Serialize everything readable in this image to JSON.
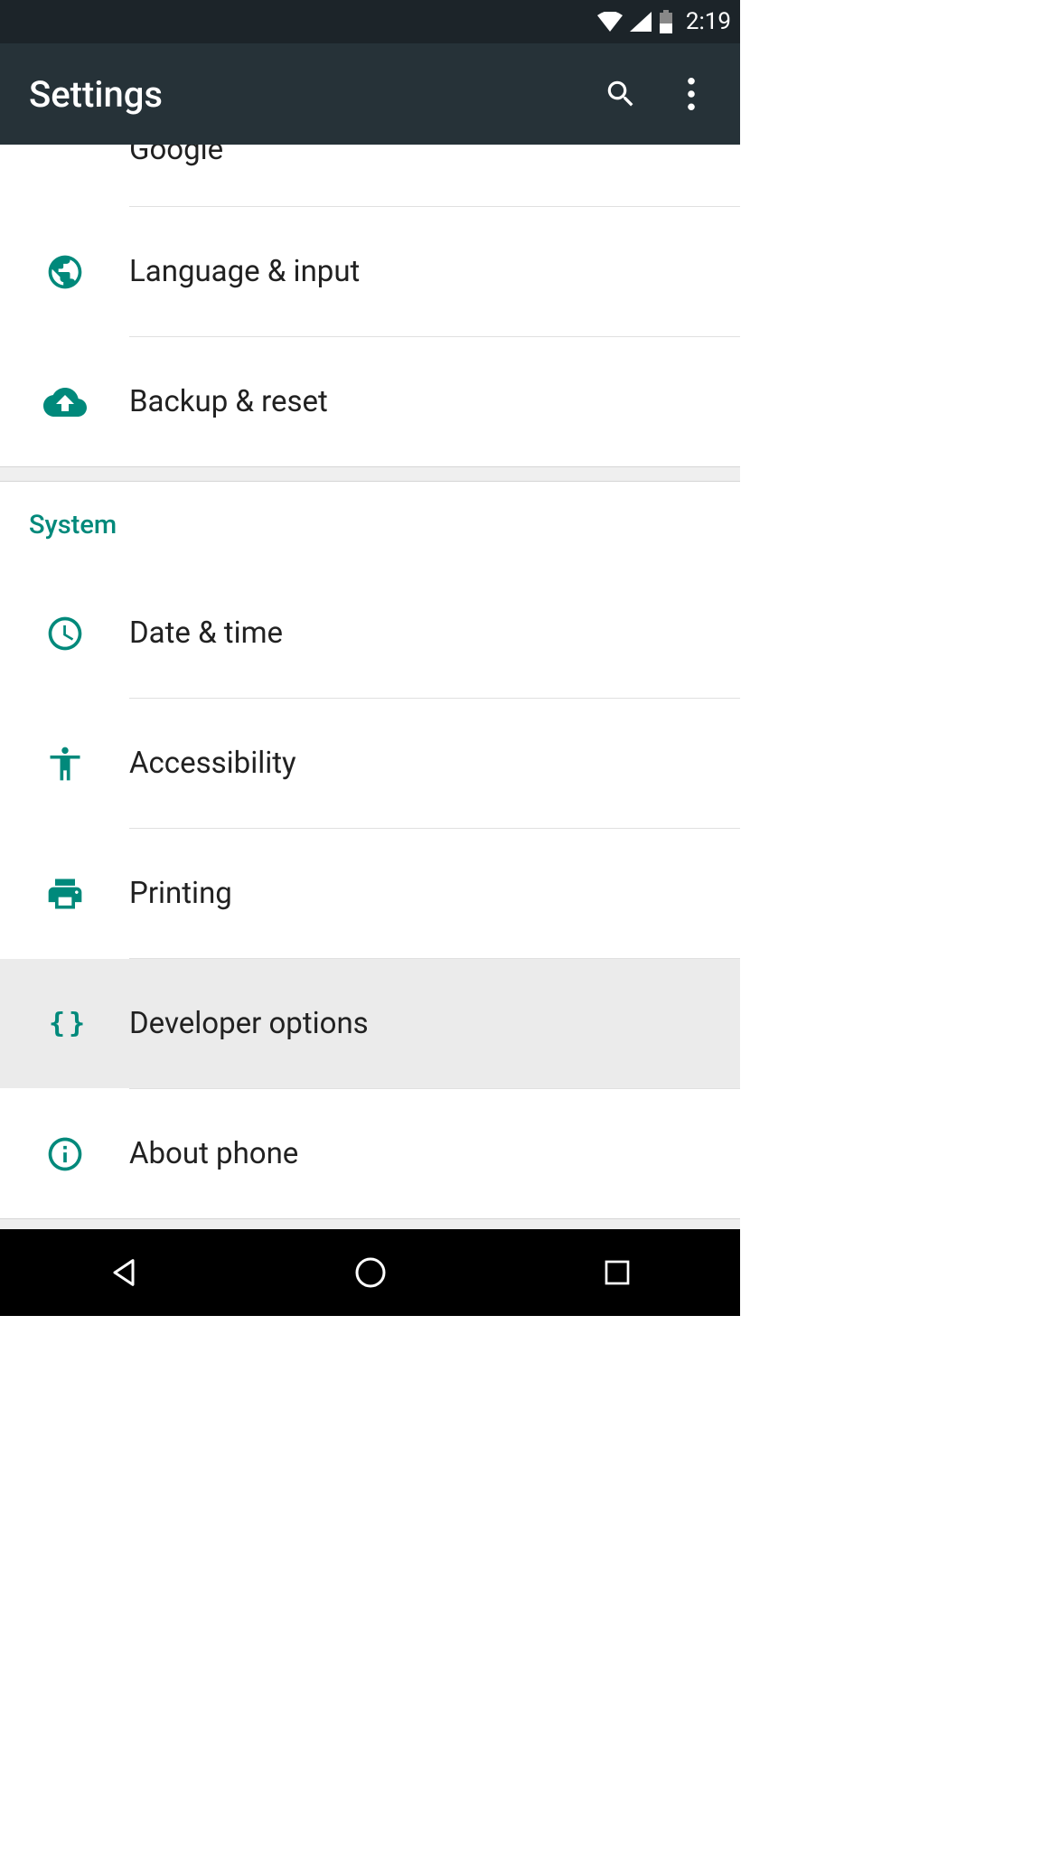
{
  "statusbar": {
    "time": "2:19"
  },
  "appbar": {
    "title": "Settings"
  },
  "sections": {
    "personal": {
      "google": "Google",
      "language_input": "Language & input",
      "backup_reset": "Backup & reset"
    },
    "system": {
      "header": "System",
      "date_time": "Date & time",
      "accessibility": "Accessibility",
      "printing": "Printing",
      "developer_options": "Developer options",
      "about_phone": "About phone"
    }
  },
  "colors": {
    "accent": "#00897b",
    "appbar_bg": "#263238",
    "statusbar_bg": "#1c2429"
  }
}
